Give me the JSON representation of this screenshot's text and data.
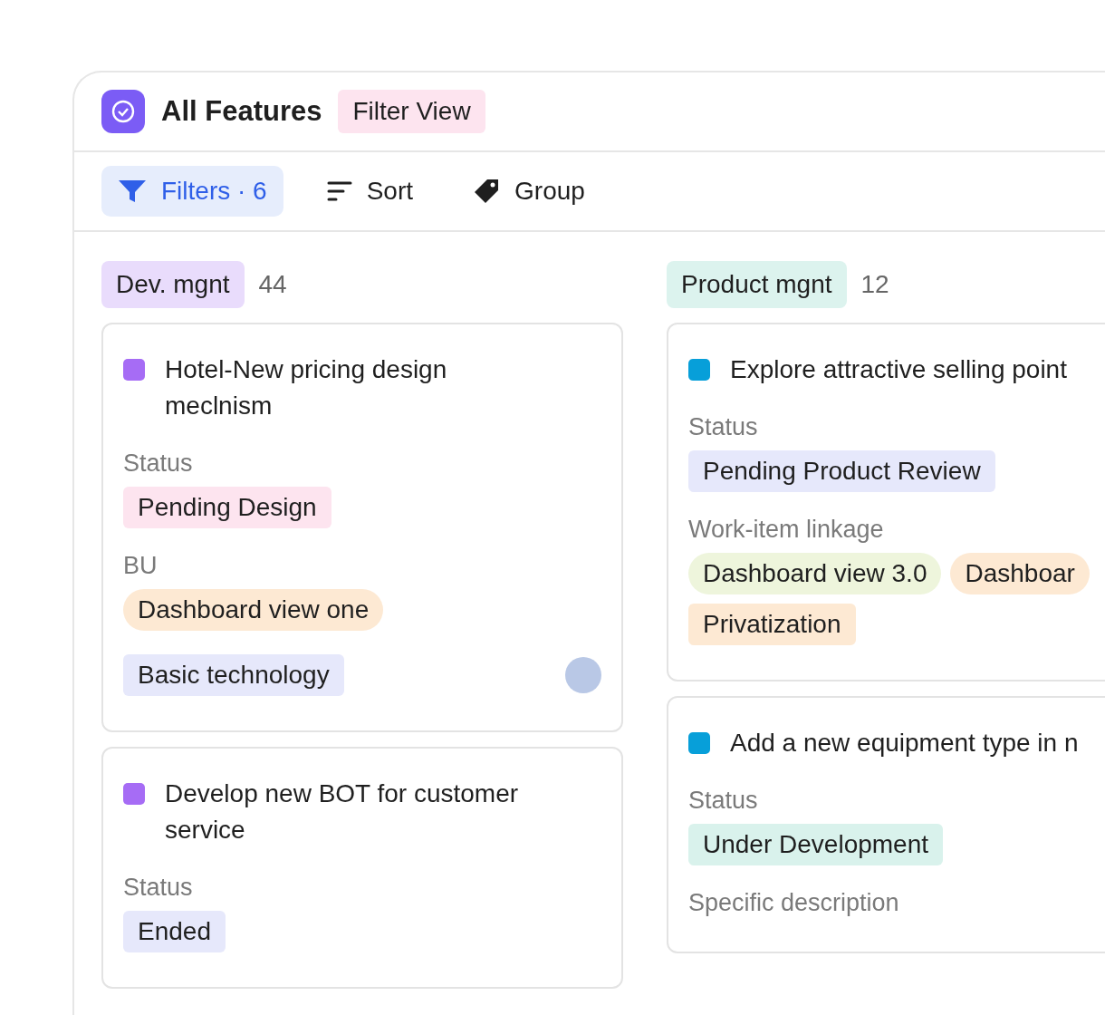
{
  "header": {
    "title": "All Features",
    "view_tag": "Filter View"
  },
  "toolbar": [
    {
      "kind": "filter",
      "label": "Filters · 6",
      "selected": true
    },
    {
      "kind": "sort",
      "label": "Sort",
      "selected": false
    },
    {
      "kind": "group",
      "label": "Group",
      "selected": false
    }
  ],
  "columns": [
    {
      "name": "Dev. mgnt",
      "count": "44",
      "color": "#e9dcfc",
      "cards": [
        {
          "title": "Hotel-New pricing design meclnism",
          "color": "#a66cf5",
          "avatar": true,
          "fields": [
            {
              "label": "Status",
              "tags": [
                {
                  "text": "Pending Design",
                  "kind": "label",
                  "color": "#fde4ef"
                }
              ]
            },
            {
              "label": "BU",
              "tags": [
                {
                  "text": "Dashboard view one",
                  "kind": "pill",
                  "color": "#fde9d3"
                }
              ]
            },
            {
              "tags": [
                {
                  "text": "Basic technology",
                  "kind": "label",
                  "color": "#e6e8fb"
                }
              ]
            }
          ]
        },
        {
          "title": "Develop new BOT for customer service",
          "color": "#a66cf5",
          "fields": [
            {
              "label": "Status",
              "tags": [
                {
                  "text": "Ended",
                  "kind": "label",
                  "color": "#e6e8fb"
                }
              ]
            }
          ]
        }
      ]
    },
    {
      "name": "Product mgnt",
      "count": "12",
      "color": "#dcf3ee",
      "cards": [
        {
          "title": "Explore attractive selling point",
          "color": "#079fd9",
          "fields": [
            {
              "label": "Status",
              "tags": [
                {
                  "text": "Pending Product Review",
                  "kind": "label",
                  "color": "#e6e8fb"
                }
              ]
            },
            {
              "label": "Work-item linkage",
              "tags": [
                {
                  "text": "Dashboard view 3.0",
                  "kind": "pill",
                  "color": "#eef5dc"
                },
                {
                  "text": "Dashboar",
                  "kind": "pill",
                  "color": "#fde9d3"
                },
                {
                  "text": "Privatization",
                  "kind": "label",
                  "color": "#fde9d3"
                }
              ]
            }
          ]
        },
        {
          "title": "Add a new equipment type in n",
          "color": "#079fd9",
          "fields": [
            {
              "label": "Status",
              "tags": [
                {
                  "text": "Under Development",
                  "kind": "label",
                  "color": "#d9f2ec"
                }
              ]
            },
            {
              "label": "Specific description"
            }
          ]
        }
      ]
    }
  ]
}
